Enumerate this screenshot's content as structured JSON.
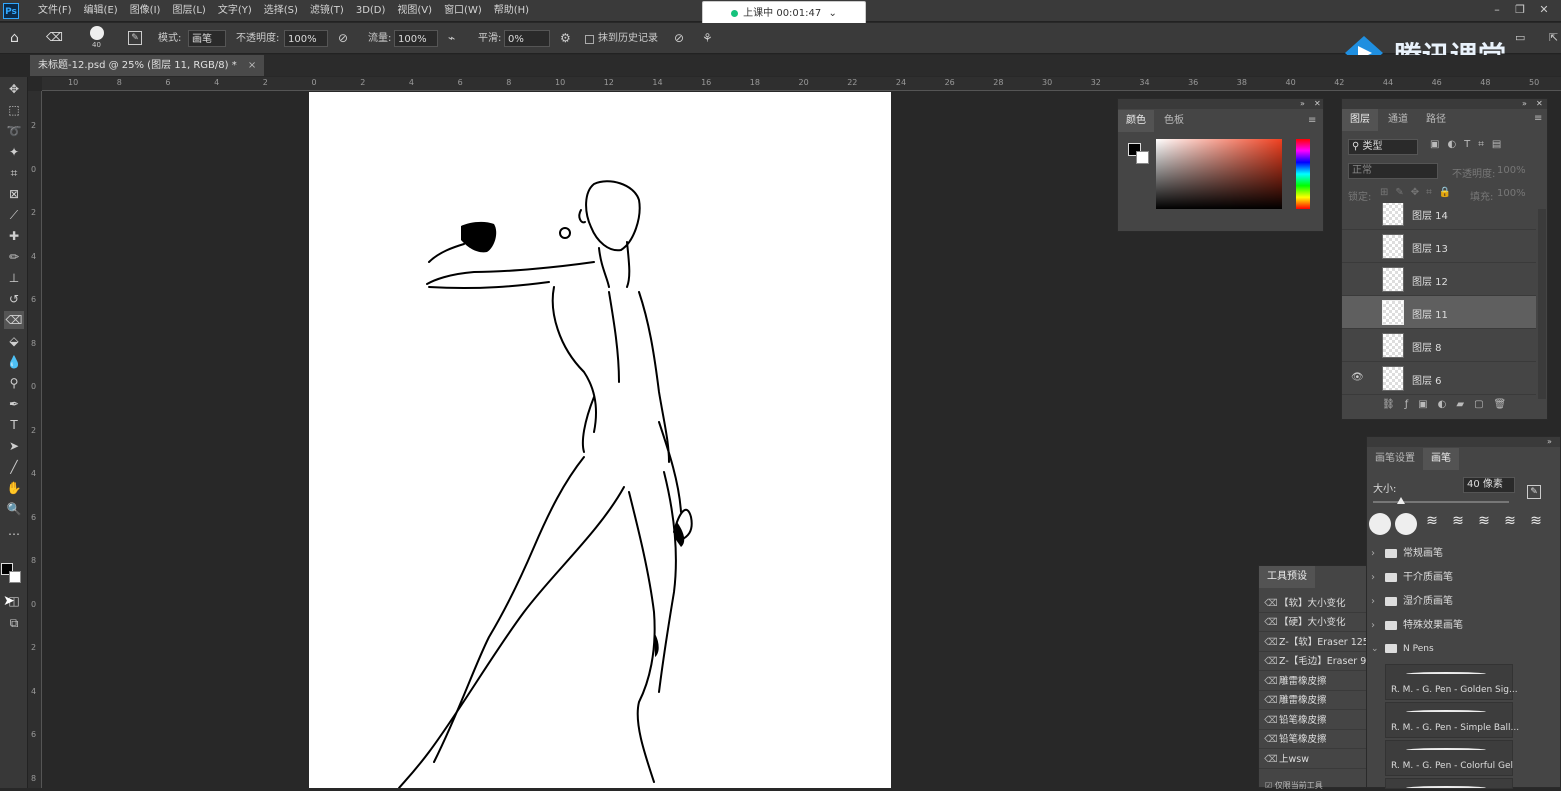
{
  "app": {
    "logo": "Ps"
  },
  "menu": [
    "文件(F)",
    "编辑(E)",
    "图像(I)",
    "图层(L)",
    "文字(Y)",
    "选择(S)",
    "滤镜(T)",
    "3D(D)",
    "视图(V)",
    "窗口(W)",
    "帮助(H)"
  ],
  "timer": {
    "text": "上课中 00:01:47"
  },
  "options": {
    "mode_label": "模式:",
    "mode_value": "画笔",
    "opacity_label": "不透明度:",
    "opacity_value": "100%",
    "flow_label": "流量:",
    "flow_value": "100%",
    "smooth_label": "平滑:",
    "smooth_value": "0%",
    "history_label": "抹到历史记录",
    "brush_size": "40"
  },
  "watermark": "腾讯课堂",
  "doc_tab": {
    "title": "未标题-12.psd @ 25% (图层 11, RGB/8) *",
    "close": "×"
  },
  "hruler_ticks": [
    "10",
    "8",
    "6",
    "4",
    "2",
    "0",
    "2",
    "4",
    "6",
    "8",
    "10",
    "12",
    "14",
    "16",
    "18",
    "20",
    "22",
    "24",
    "26",
    "28",
    "30",
    "32",
    "34",
    "36",
    "38",
    "40",
    "42",
    "44",
    "46",
    "48",
    "50"
  ],
  "vruler_ticks": [
    "2",
    "0",
    "2",
    "4",
    "6",
    "8",
    "0",
    "2",
    "4",
    "6",
    "8",
    "0",
    "2",
    "4",
    "6",
    "8"
  ],
  "color_panel": {
    "tabs": [
      "颜色",
      "色板"
    ]
  },
  "layers_panel": {
    "tabs": [
      "图层",
      "通道",
      "路径"
    ],
    "filter": "类型",
    "blend": "正常",
    "opacity_label": "不透明度:",
    "opacity_value": "100%",
    "lock_label": "锁定:",
    "fill_label": "填充:",
    "fill_value": "100%",
    "layers": [
      {
        "name": "图层 14",
        "visible": false,
        "selected": false
      },
      {
        "name": "图层 13",
        "visible": false,
        "selected": false
      },
      {
        "name": "图层 12",
        "visible": false,
        "selected": false
      },
      {
        "name": "图层 11",
        "visible": false,
        "selected": true
      },
      {
        "name": "图层 8",
        "visible": false,
        "selected": false
      },
      {
        "name": "图层 6",
        "visible": true,
        "selected": false
      }
    ]
  },
  "tool_presets": {
    "title": "工具预设",
    "items": [
      "【软】大小变化",
      "【硬】大小变化",
      "Z-【软】Eraser 125",
      "Z-【毛边】Eraser 9",
      "雕雷橡皮擦",
      "雕雷橡皮擦",
      "铅笔橡皮擦",
      "铅笔橡皮擦",
      "上wsw"
    ],
    "footer": "仅限当前工具"
  },
  "brushes_panel": {
    "tabs": [
      "画笔设置",
      "画笔"
    ],
    "size_label": "大小:",
    "size_value": "40 像素",
    "folders": [
      "常规画笔",
      "干介质画笔",
      "湿介质画笔",
      "特殊效果画笔",
      "N Pens"
    ],
    "brushes": [
      "R. M. - G. Pen - Golden Sig...",
      "R. M. - G. Pen - Simple Ball...",
      "R. M. - G. Pen - Colorful Gel"
    ]
  }
}
